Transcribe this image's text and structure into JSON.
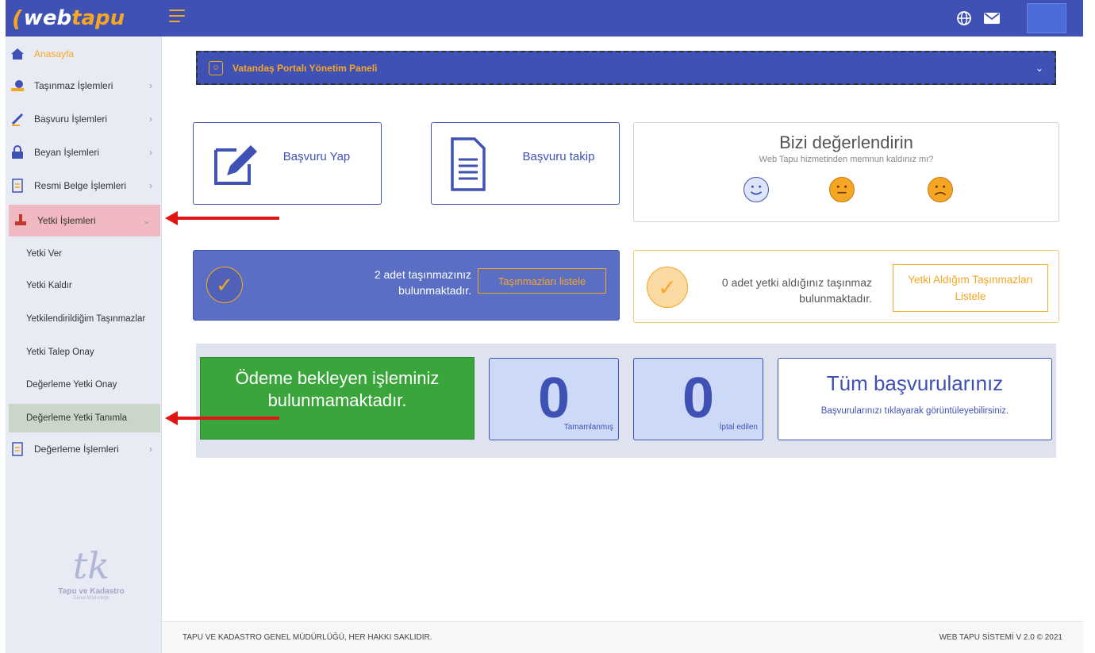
{
  "brand": {
    "logo_main": "web",
    "logo_accent": "tapu"
  },
  "topbar": {
    "globe_icon": "globe-icon",
    "mail_icon": "mail-icon"
  },
  "sidebar": {
    "items": [
      {
        "label": "Anasayfa",
        "icon": "home-icon"
      },
      {
        "label": "Taşınmaz İşlemleri",
        "icon": "property-icon"
      },
      {
        "label": "Başvuru İşlemleri",
        "icon": "pen-icon"
      },
      {
        "label": "Beyan İşlemleri",
        "icon": "lock-icon"
      },
      {
        "label": "Resmi Belge İşlemleri",
        "icon": "document-icon"
      },
      {
        "label": "Yetki İşlemleri",
        "icon": "stamp-icon"
      },
      {
        "label": "Değerleme İşlemleri",
        "icon": "document-icon"
      }
    ],
    "subitems": [
      {
        "label": "Yetki Ver"
      },
      {
        "label": "Yetki Kaldır"
      },
      {
        "label": "Yetkilendirildiğim Taşınmazlar"
      },
      {
        "label": "Yetki Talep Onay"
      },
      {
        "label": "Değerleme Yetki Onay"
      },
      {
        "label": "Değerleme Yetki Tanımla"
      }
    ],
    "org_logo": {
      "name": "Tapu ve Kadastro",
      "sub": "Genel Müdürlüğü"
    }
  },
  "panel_header": {
    "title": "Vatandaş Portalı Yönetim Paneli"
  },
  "cards": {
    "apply": {
      "label": "Başvuru Yap"
    },
    "track": {
      "label": "Başvuru takip"
    }
  },
  "rating": {
    "title": "Bizi değerlendirin",
    "subtitle": "Web Tapu hizmetinden memnun kaldınız mı?"
  },
  "info_properties": {
    "text": "2 adet taşınmazınız bulunmaktadır.",
    "button": "Taşınmazları listele"
  },
  "info_authorized": {
    "text": "0 adet yetki aldığınız taşınmaz bulunmaktadır.",
    "button": "Yetki Aldığım Taşınmazları Listele"
  },
  "payment": {
    "text": "Ödeme bekleyen işleminiz bulunmamaktadır."
  },
  "stats": {
    "completed": {
      "value": "0",
      "label": "Tamamlanmış"
    },
    "cancelled": {
      "value": "0",
      "label": "İptal edilen"
    }
  },
  "all_applications": {
    "title": "Tüm başvurularınız",
    "subtitle": "Başvurularınızı tıklayarak görüntüleyebilirsiniz."
  },
  "footer": {
    "left": "TAPU VE KADASTRO GENEL MÜDÜRLÜĞÜ, HER HAKKI SAKLIDIR.",
    "right": "WEB TAPU SİSTEMİ V 2.0 © 2021"
  },
  "colors": {
    "primary": "#3f51b5",
    "accent": "#f5a623",
    "success": "#3aa53a",
    "annotation": "#e21515"
  }
}
